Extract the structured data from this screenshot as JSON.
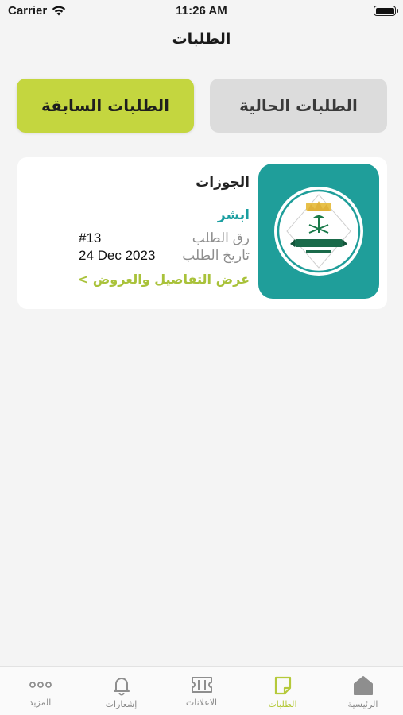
{
  "status_bar": {
    "carrier": "Carrier",
    "time": "11:26 AM"
  },
  "header": {
    "title": "الطلبات"
  },
  "tabs": [
    {
      "label": "الطلبات الحالية",
      "active": false
    },
    {
      "label": "الطلبات السابقة",
      "active": true
    }
  ],
  "request": {
    "title": "الجوزات",
    "provider": "ابشر",
    "number_label": "رق الطلب",
    "number_value": "#13",
    "date_label": "تاريخ الطلب",
    "date_value": "24 Dec 2023",
    "details_link": "عرض التفاصيل والعروض >",
    "image_icon": "jawazat-logo"
  },
  "bottom_nav": [
    {
      "label": "الرئيسية",
      "icon": "home-icon"
    },
    {
      "label": "الطلبات",
      "icon": "orders-icon",
      "active": true
    },
    {
      "label": "الاعلانات",
      "icon": "ticket-icon"
    },
    {
      "label": "إشعارات",
      "icon": "bell-icon"
    },
    {
      "label": "المزيد",
      "icon": "more-icon"
    }
  ],
  "colors": {
    "accent": "#c4d63f",
    "teal": "#1f9e9a",
    "background": "#f4f4f4"
  }
}
